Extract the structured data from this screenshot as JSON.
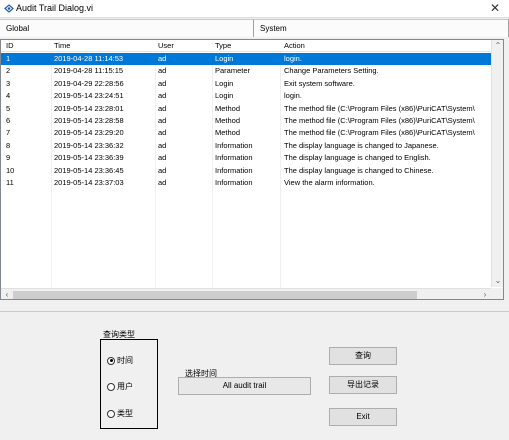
{
  "window": {
    "title": "Audit Trail Dialog.vi",
    "close_glyph": "✕",
    "app_icon": "labview-vi-icon"
  },
  "tabs": [
    {
      "label": "Global"
    },
    {
      "label": "System"
    }
  ],
  "table": {
    "columns": [
      "ID",
      "Time",
      "User",
      "Type",
      "Action"
    ],
    "selected_index": 0,
    "rows": [
      [
        "1",
        "2019-04-28 11:14:53",
        "ad",
        "Login",
        "login."
      ],
      [
        "2",
        "2019-04-28 11:15:15",
        "ad",
        "Parameter",
        "Change Parameters Setting."
      ],
      [
        "3",
        "2019-04-29 22:28:56",
        "ad",
        "Login",
        "Exit system software."
      ],
      [
        "4",
        "2019-05-14 23:24:51",
        "ad",
        "Login",
        "login."
      ],
      [
        "5",
        "2019-05-14 23:28:01",
        "ad",
        "Method",
        "The method file (C:\\Program Files (x86)\\PuriCAT\\System\\"
      ],
      [
        "6",
        "2019-05-14 23:28:58",
        "ad",
        "Method",
        "The method file (C:\\Program Files (x86)\\PuriCAT\\System\\"
      ],
      [
        "7",
        "2019-05-14 23:29:20",
        "ad",
        "Method",
        "The method file (C:\\Program Files (x86)\\PuriCAT\\System\\"
      ],
      [
        "8",
        "2019-05-14 23:36:32",
        "ad",
        "Information",
        "The display language is changed to Japanese."
      ],
      [
        "9",
        "2019-05-14 23:36:39",
        "ad",
        "Information",
        "The display language is changed to English."
      ],
      [
        "10",
        "2019-05-14 23:36:45",
        "ad",
        "Information",
        "The display language is changed to Chinese."
      ],
      [
        "11",
        "2019-05-14 23:37:03",
        "ad",
        "Information",
        "View the alarm information."
      ]
    ]
  },
  "scroll": {
    "up": "⌃",
    "down": "⌄",
    "left": "‹",
    "right": "›"
  },
  "query_type": {
    "label": "查询类型",
    "options": [
      {
        "label": "时间",
        "selected": true
      },
      {
        "label": "用户",
        "selected": false
      },
      {
        "label": "类型",
        "selected": false
      }
    ]
  },
  "time_select": {
    "label": "选择时间",
    "value": "All audit trail"
  },
  "buttons": {
    "query": "查询",
    "export": "导出记录",
    "exit": "Exit"
  },
  "colors": {
    "selection": "#0078d7"
  }
}
